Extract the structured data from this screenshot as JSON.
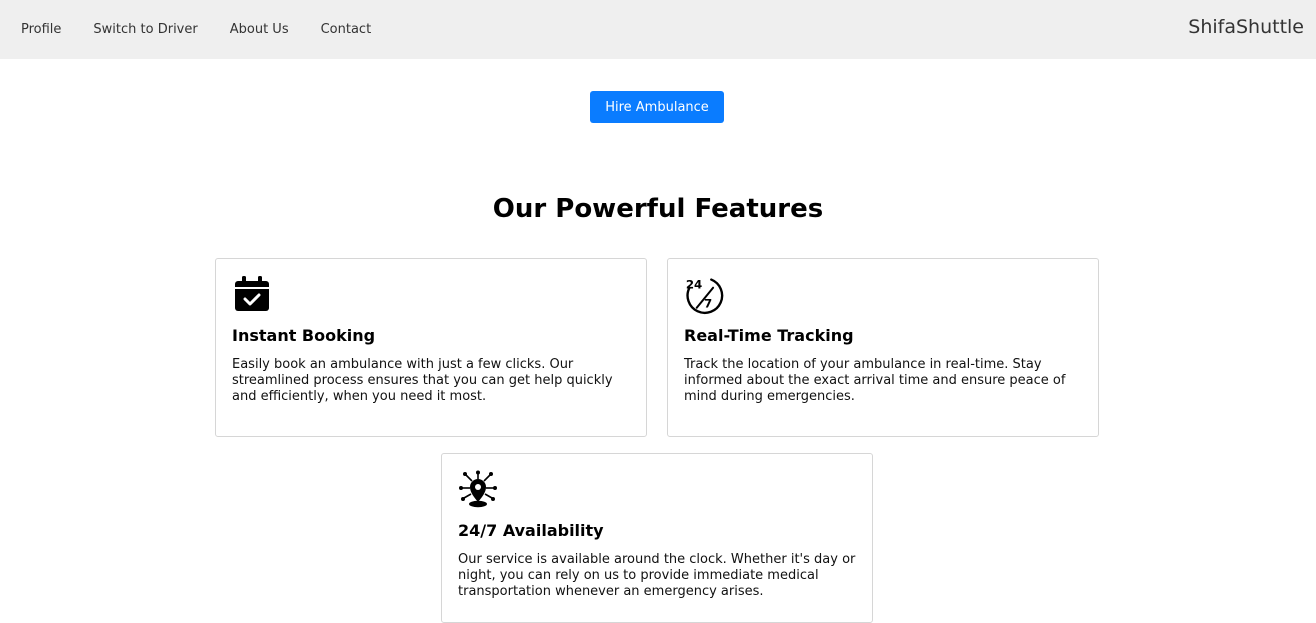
{
  "nav": {
    "links": [
      "Profile",
      "Switch to Driver",
      "About Us",
      "Contact"
    ],
    "brand": "ShifaShuttle"
  },
  "hero": {
    "button_label": "Hire Ambulance",
    "button_color": "#0a7cff"
  },
  "features": {
    "title": "Our Powerful Features",
    "cards": [
      {
        "icon": "calendar-check-icon",
        "title": "Instant Booking",
        "text": "Easily book an ambulance with just a few clicks. Our streamlined process ensures that you can get help quickly and efficiently, when you need it most."
      },
      {
        "icon": "clock-24-7-icon",
        "title": "Real-Time Tracking",
        "text": "Track the location of your ambulance in real-time. Stay informed about the exact arrival time and ensure peace of mind during emergencies."
      },
      {
        "icon": "location-network-icon",
        "title": "24/7 Availability",
        "text": "Our service is available around the clock. Whether it's day or night, you can rely on us to provide immediate medical transportation whenever an emergency arises."
      }
    ]
  },
  "icon_24_7": {
    "top": "24",
    "bottom": "7"
  }
}
